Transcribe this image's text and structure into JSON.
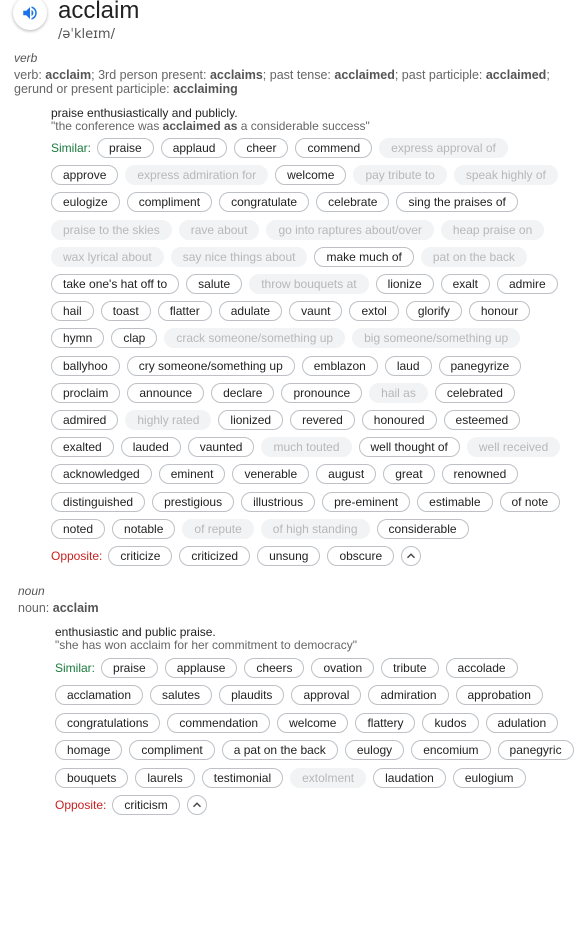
{
  "word": "acclaim",
  "phonetic": "/əˈkleɪm/",
  "verb": {
    "pos": "verb",
    "forms_line1": [
      {
        "t": "verb: ",
        "b": false
      },
      {
        "t": "acclaim",
        "b": true
      },
      {
        "t": "; 3rd person present: ",
        "b": false
      },
      {
        "t": "acclaims",
        "b": true
      },
      {
        "t": "; past tense: ",
        "b": false
      },
      {
        "t": "acclaimed",
        "b": true
      },
      {
        "t": "; past participle: ",
        "b": false
      },
      {
        "t": "acclaimed",
        "b": true
      },
      {
        "t": ";",
        "b": false
      }
    ],
    "forms_line2": [
      {
        "t": "gerund or present participle: ",
        "b": false
      },
      {
        "t": "acclaiming",
        "b": true
      }
    ],
    "definition": "praise enthusiastically and publicly.",
    "example": [
      {
        "t": "\"the conference was ",
        "b": false
      },
      {
        "t": "acclaimed as",
        "b": true
      },
      {
        "t": " a considerable success\"",
        "b": false
      }
    ],
    "similar_label": "Similar:",
    "similar_rows": [
      [
        [
          "praise",
          1
        ],
        [
          "applaud",
          1
        ],
        [
          "cheer",
          1
        ],
        [
          "commend",
          1
        ],
        [
          "express approval of",
          0
        ]
      ],
      [
        [
          "approve",
          1
        ],
        [
          "express admiration for",
          0
        ],
        [
          "welcome",
          1
        ],
        [
          "pay tribute to",
          0
        ],
        [
          "speak highly of",
          0
        ]
      ],
      [
        [
          "eulogize",
          1
        ],
        [
          "compliment",
          1
        ],
        [
          "congratulate",
          1
        ],
        [
          "celebrate",
          1
        ],
        [
          "sing the praises of",
          1
        ]
      ],
      [
        [
          "praise to the skies",
          0
        ],
        [
          "rave about",
          0
        ],
        [
          "go into raptures about/over",
          0
        ],
        [
          "heap praise on",
          0
        ]
      ],
      [
        [
          "wax lyrical about",
          0
        ],
        [
          "say nice things about",
          0
        ],
        [
          "make much of",
          1
        ],
        [
          "pat on the back",
          0
        ]
      ],
      [
        [
          "take one's hat off to",
          1
        ],
        [
          "salute",
          1
        ],
        [
          "throw bouquets at",
          0
        ],
        [
          "lionize",
          1
        ],
        [
          "exalt",
          1
        ],
        [
          "admire",
          1
        ]
      ],
      [
        [
          "hail",
          1
        ],
        [
          "toast",
          1
        ],
        [
          "flatter",
          1
        ],
        [
          "adulate",
          1
        ],
        [
          "vaunt",
          1
        ],
        [
          "extol",
          1
        ],
        [
          "glorify",
          1
        ],
        [
          "honour",
          1
        ]
      ],
      [
        [
          "hymn",
          1
        ],
        [
          "clap",
          1
        ],
        [
          "crack someone/something up",
          0
        ],
        [
          "big someone/something up",
          0
        ]
      ],
      [
        [
          "ballyhoo",
          1
        ],
        [
          "cry someone/something up",
          1
        ],
        [
          "emblazon",
          1
        ],
        [
          "laud",
          1
        ],
        [
          "panegyrize",
          1
        ]
      ],
      [
        [
          "proclaim",
          1
        ],
        [
          "announce",
          1
        ],
        [
          "declare",
          1
        ],
        [
          "pronounce",
          1
        ],
        [
          "hail as",
          0
        ],
        [
          "celebrated",
          1
        ]
      ],
      [
        [
          "admired",
          1
        ],
        [
          "highly rated",
          0
        ],
        [
          "lionized",
          1
        ],
        [
          "revered",
          1
        ],
        [
          "honoured",
          1
        ],
        [
          "esteemed",
          1
        ]
      ],
      [
        [
          "exalted",
          1
        ],
        [
          "lauded",
          1
        ],
        [
          "vaunted",
          1
        ],
        [
          "much touted",
          0
        ],
        [
          "well thought of",
          1
        ],
        [
          "well received",
          0
        ]
      ],
      [
        [
          "acknowledged",
          1
        ],
        [
          "eminent",
          1
        ],
        [
          "venerable",
          1
        ],
        [
          "august",
          1
        ],
        [
          "great",
          1
        ],
        [
          "renowned",
          1
        ]
      ],
      [
        [
          "distinguished",
          1
        ],
        [
          "prestigious",
          1
        ],
        [
          "illustrious",
          1
        ],
        [
          "pre-eminent",
          1
        ],
        [
          "estimable",
          1
        ],
        [
          "of note",
          1
        ]
      ],
      [
        [
          "noted",
          1
        ],
        [
          "notable",
          1
        ],
        [
          "of repute",
          0
        ],
        [
          "of high standing",
          0
        ],
        [
          "considerable",
          1
        ]
      ]
    ],
    "opposite_label": "Opposite:",
    "opposites": [
      [
        "criticize",
        1
      ],
      [
        "criticized",
        1
      ],
      [
        "unsung",
        1
      ],
      [
        "obscure",
        1
      ]
    ]
  },
  "noun": {
    "pos": "noun",
    "forms_line1": [
      {
        "t": "noun: ",
        "b": false
      },
      {
        "t": "acclaim",
        "b": true
      }
    ],
    "definition": "enthusiastic and public praise.",
    "example": [
      {
        "t": "\"she has won acclaim for her commitment to democracy\"",
        "b": false
      }
    ],
    "similar_label": "Similar:",
    "similar_rows": [
      [
        [
          "praise",
          1
        ],
        [
          "applause",
          1
        ],
        [
          "cheers",
          1
        ],
        [
          "ovation",
          1
        ],
        [
          "tribute",
          1
        ],
        [
          "accolade",
          1
        ]
      ],
      [
        [
          "acclamation",
          1
        ],
        [
          "salutes",
          1
        ],
        [
          "plaudits",
          1
        ],
        [
          "approval",
          1
        ],
        [
          "admiration",
          1
        ],
        [
          "approbation",
          1
        ]
      ],
      [
        [
          "congratulations",
          1
        ],
        [
          "commendation",
          1
        ],
        [
          "welcome",
          1
        ],
        [
          "flattery",
          1
        ],
        [
          "kudos",
          1
        ],
        [
          "adulation",
          1
        ]
      ],
      [
        [
          "homage",
          1
        ],
        [
          "compliment",
          1
        ],
        [
          "a pat on the back",
          1
        ],
        [
          "eulogy",
          1
        ],
        [
          "encomium",
          1
        ],
        [
          "panegyric",
          1
        ]
      ],
      [
        [
          "bouquets",
          1
        ],
        [
          "laurels",
          1
        ],
        [
          "testimonial",
          1
        ],
        [
          "extolment",
          0
        ],
        [
          "laudation",
          1
        ],
        [
          "eulogium",
          1
        ]
      ]
    ],
    "opposite_label": "Opposite:",
    "opposites": [
      [
        "criticism",
        1
      ]
    ]
  }
}
